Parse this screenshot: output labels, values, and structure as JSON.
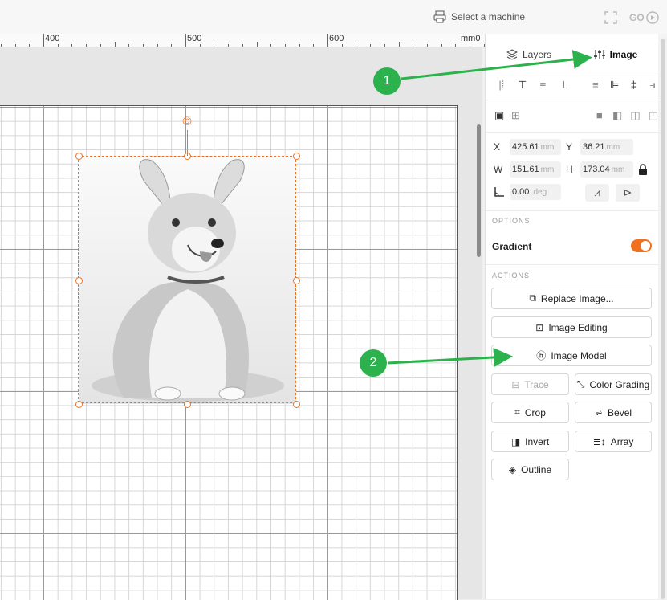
{
  "topbar": {
    "machine_label": "Select a machine",
    "go_label": "GO"
  },
  "ruler": {
    "labels": [
      "400",
      "500",
      "600",
      "mm0"
    ]
  },
  "panel": {
    "tabs": [
      {
        "label": "Layers",
        "icon": "layers-icon",
        "active": false
      },
      {
        "label": "Image",
        "icon": "sliders-icon",
        "active": true
      }
    ],
    "fields": {
      "x": {
        "label": "X",
        "value": "425.61",
        "unit": "mm"
      },
      "y": {
        "label": "Y",
        "value": "36.21",
        "unit": "mm"
      },
      "w": {
        "label": "W",
        "value": "151.61",
        "unit": "mm"
      },
      "h": {
        "label": "H",
        "value": "173.04",
        "unit": "mm"
      },
      "rotation": {
        "value": "0.00",
        "unit": "deg"
      }
    },
    "options_title": "OPTIONS",
    "gradient_label": "Gradient",
    "gradient_on": true,
    "actions_title": "ACTIONS",
    "buttons": {
      "replace": "Replace Image...",
      "editing": "Image Editing",
      "model": "Image Model",
      "trace": "Trace",
      "color_grading": "Color Grading",
      "crop": "Crop",
      "bevel": "Bevel",
      "invert": "Invert",
      "array": "Array",
      "outline": "Outline"
    }
  },
  "annotations": {
    "badge1": "1",
    "badge2": "2"
  },
  "colors": {
    "accent": "#f07020",
    "annotation": "#2bb24c"
  }
}
